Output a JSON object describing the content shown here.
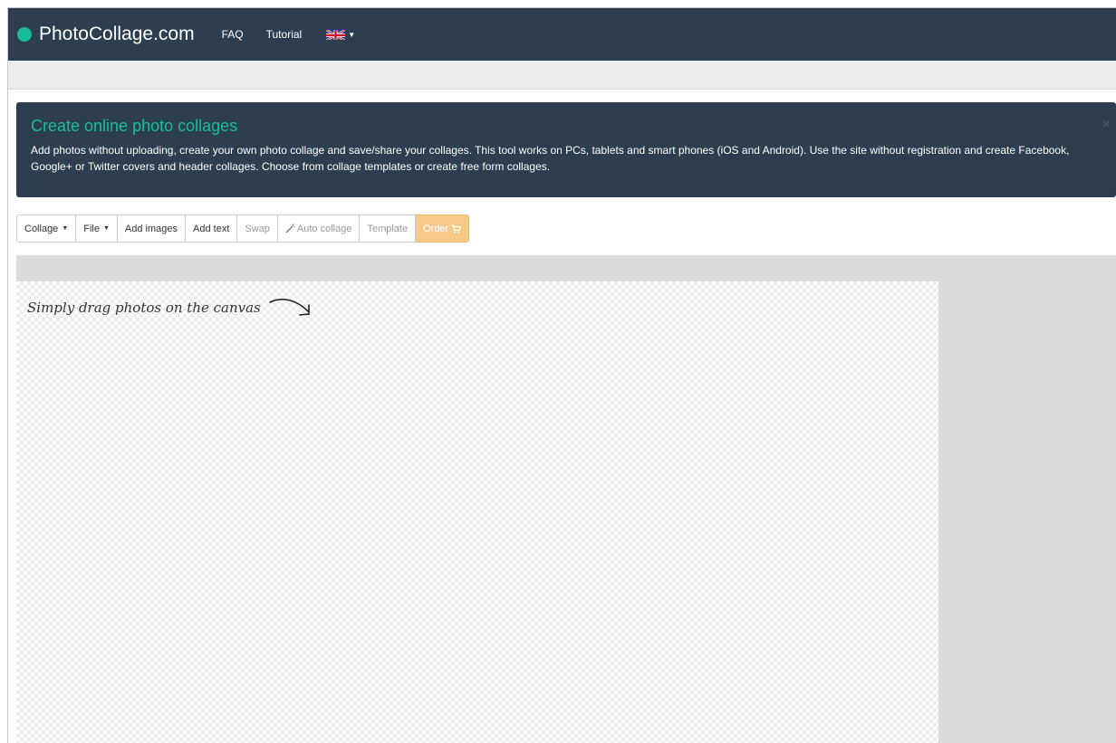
{
  "navbar": {
    "brand": "PhotoCollage.com",
    "links": [
      "FAQ",
      "Tutorial"
    ],
    "language_flag": "uk-flag-icon",
    "brand_color": "#18bc9c",
    "bg_color": "#2c3e50"
  },
  "alert": {
    "title": "Create online photo collages",
    "text": "Add photos without uploading, create your own photo collage and save/share your collages. This tool works on PCs, tablets and smart phones (iOS and Android). Use the site without registration and create Facebook, Google+ or Twitter covers and header collages. Choose from collage templates or create free form collages.",
    "close": "×"
  },
  "toolbar": {
    "collage": "Collage",
    "file": "File",
    "add_images": "Add images",
    "add_text": "Add text",
    "swap": "Swap",
    "auto_collage": "Auto collage",
    "template": "Template",
    "order": "Order",
    "order_color": "#f8c987"
  },
  "canvas": {
    "hint": "Simply drag photos on the canvas"
  }
}
